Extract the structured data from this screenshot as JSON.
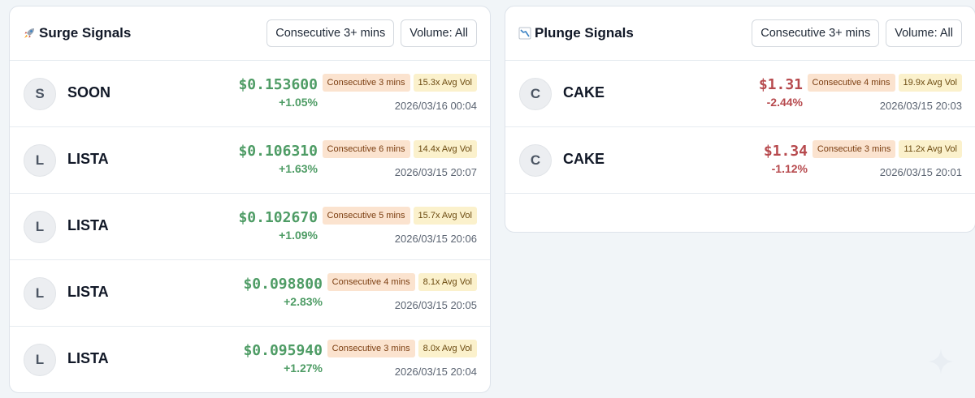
{
  "surge": {
    "title": "Surge Signals",
    "icon": "rocket-icon",
    "filter_consecutive": "Consecutive 3+ mins",
    "filter_volume": "Volume: All",
    "rows": [
      {
        "avatar": "S",
        "symbol": "SOON",
        "price": "$0.153600",
        "change": "+1.05%",
        "consecutive": "Consecutive 3 mins",
        "volume": "15.3x Avg Vol",
        "time": "2026/03/16 00:04"
      },
      {
        "avatar": "L",
        "symbol": "LISTA",
        "price": "$0.106310",
        "change": "+1.63%",
        "consecutive": "Consecutive 6 mins",
        "volume": "14.4x Avg Vol",
        "time": "2026/03/15 20:07"
      },
      {
        "avatar": "L",
        "symbol": "LISTA",
        "price": "$0.102670",
        "change": "+1.09%",
        "consecutive": "Consecutive 5 mins",
        "volume": "15.7x Avg Vol",
        "time": "2026/03/15 20:06"
      },
      {
        "avatar": "L",
        "symbol": "LISTA",
        "price": "$0.098800",
        "change": "+2.83%",
        "consecutive": "Consecutive 4 mins",
        "volume": "8.1x Avg Vol",
        "time": "2026/03/15 20:05"
      },
      {
        "avatar": "L",
        "symbol": "LISTA",
        "price": "$0.095940",
        "change": "+1.27%",
        "consecutive": "Consecutive 3 mins",
        "volume": "8.0x Avg Vol",
        "time": "2026/03/15 20:04"
      }
    ]
  },
  "plunge": {
    "title": "Plunge Signals",
    "icon": "chart-decreasing-icon",
    "filter_consecutive": "Consecutive 3+ mins",
    "filter_volume": "Volume: All",
    "rows": [
      {
        "avatar": "C",
        "symbol": "CAKE",
        "price": "$1.31",
        "change": "-2.44%",
        "consecutive": "Consecutive 4 mins",
        "volume": "19.9x Avg Vol",
        "time": "2026/03/15 20:03"
      },
      {
        "avatar": "C",
        "symbol": "CAKE",
        "price": "$1.34",
        "change": "-1.12%",
        "consecutive": "Consecutie 3 mins",
        "volume": "11.2x Avg Vol",
        "time": "2026/03/15 20:01"
      }
    ]
  },
  "colors": {
    "up": "#4e9c65",
    "down": "#b74a4e",
    "consecutive_badge_bg": "#fbe3cf",
    "volume_badge_bg": "#fbf1cc"
  }
}
